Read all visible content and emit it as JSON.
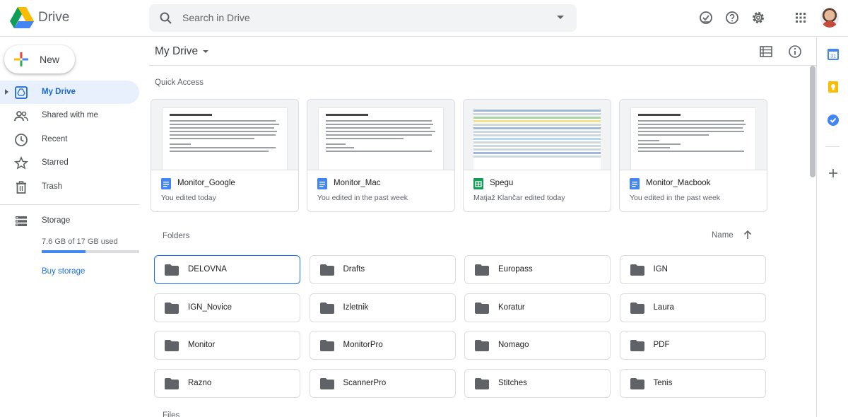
{
  "app": {
    "name": "Drive"
  },
  "search": {
    "placeholder": "Search in Drive"
  },
  "header_icons": [
    "offline-check-icon",
    "help-icon",
    "settings-icon",
    "apps-grid-icon"
  ],
  "new_button": {
    "label": "New"
  },
  "nav": {
    "items": [
      {
        "label": "My Drive",
        "icon": "my-drive-icon",
        "active": true
      },
      {
        "label": "Shared with me",
        "icon": "people-icon",
        "active": false
      },
      {
        "label": "Recent",
        "icon": "clock-icon",
        "active": false
      },
      {
        "label": "Starred",
        "icon": "star-icon",
        "active": false
      },
      {
        "label": "Trash",
        "icon": "trash-icon",
        "active": false
      }
    ],
    "storage_label": "Storage",
    "storage_used": "7.6 GB of 17 GB used",
    "storage_fraction": 0.447,
    "buy_storage": "Buy storage"
  },
  "main": {
    "breadcrumb": "My Drive",
    "quick_access_label": "Quick Access",
    "quick_access": [
      {
        "title": "Monitor_Google",
        "subtitle": "You edited today",
        "type": "doc"
      },
      {
        "title": "Monitor_Mac",
        "subtitle": "You edited in the past week",
        "type": "doc"
      },
      {
        "title": "Spegu",
        "subtitle": "Matjaž Klančar edited today",
        "type": "sheet"
      },
      {
        "title": "Monitor_Macbook",
        "subtitle": "You edited in the past week",
        "type": "doc"
      }
    ],
    "folders_label": "Folders",
    "sort_label": "Name",
    "folders": [
      "DELOVNA",
      "Drafts",
      "Europass",
      "IGN",
      "IGN_Novice",
      "Izletnik",
      "Koratur",
      "Laura",
      "Monitor",
      "MonitorPro",
      "Nomago",
      "PDF",
      "Razno",
      "ScannerPro",
      "Stitches",
      "Tenis"
    ],
    "selected_folder": "DELOVNA",
    "files_label": "Files"
  },
  "colors": {
    "accent": "#1a73e8",
    "active_bg": "#e8f0fe",
    "doc_blue": "#4285f4",
    "sheet_green": "#0f9d58"
  }
}
